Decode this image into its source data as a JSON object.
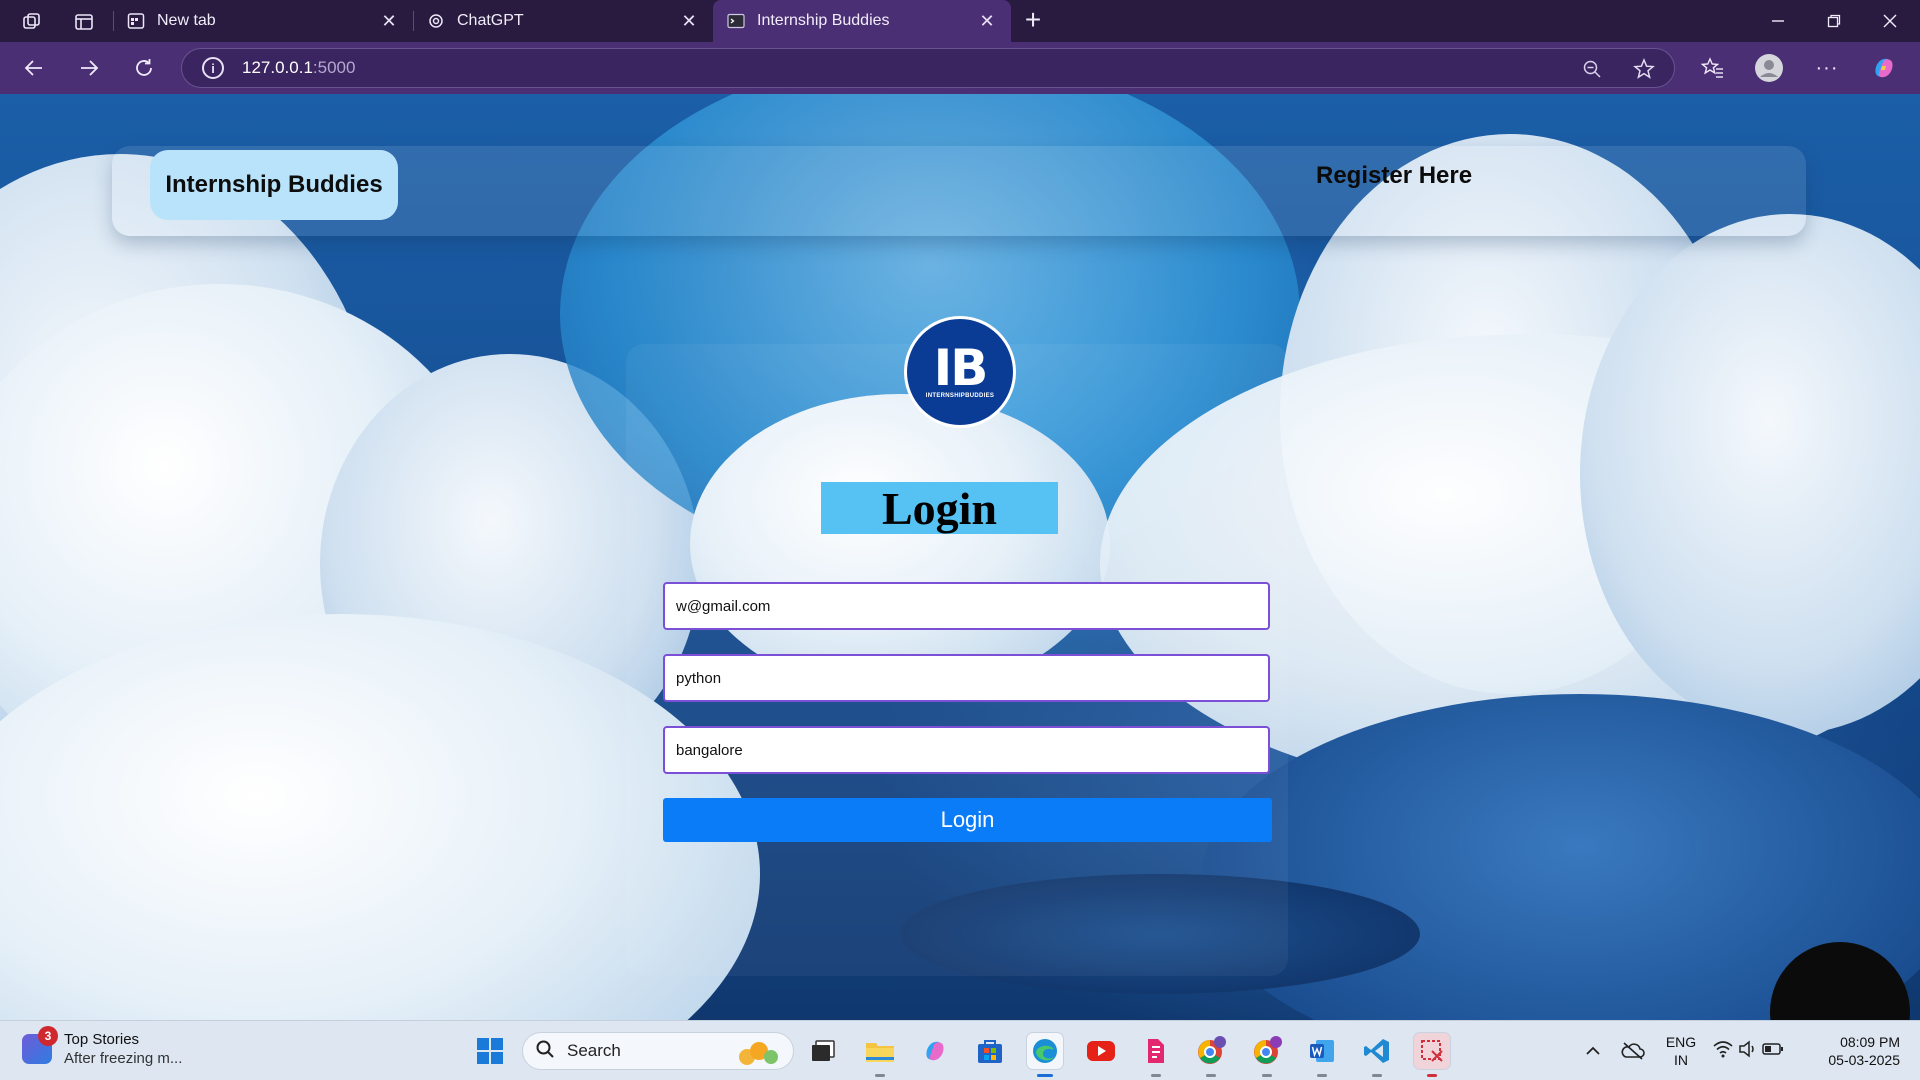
{
  "browser": {
    "tabs": [
      {
        "title": "New tab",
        "icon": "newtab-icon",
        "active": false
      },
      {
        "title": "ChatGPT",
        "icon": "chatgpt-icon",
        "active": false
      },
      {
        "title": "Internship Buddies",
        "icon": "terminal-icon",
        "active": true
      }
    ],
    "address": {
      "host": "127.0.0.1",
      "port": ":5000"
    }
  },
  "page": {
    "brand": "Internship Buddies",
    "register_link": "Register Here",
    "logo": {
      "main": "IB",
      "sub": "INTERNSHIPBUDDIES"
    },
    "login_title": "Login",
    "fields": [
      {
        "value": "w@gmail.com"
      },
      {
        "value": "python"
      },
      {
        "value": "bangalore"
      }
    ],
    "submit_label": "Login"
  },
  "taskbar": {
    "news": {
      "badge": "3",
      "title": "Top Stories",
      "subtitle": "After freezing m..."
    },
    "search_label": "Search",
    "lang": {
      "line1": "ENG",
      "line2": "IN"
    },
    "clock": {
      "time": "08:09 PM",
      "date": "05-03-2025"
    }
  },
  "colors": {
    "chrome_tabbar": "#281b3f",
    "chrome_toolbar": "#4b2f74",
    "brand_bg": "#b9e2fb",
    "login_title_bg": "#56c2f3",
    "submit_bg": "#0a7cf8",
    "field_border": "#7b4fd6"
  }
}
